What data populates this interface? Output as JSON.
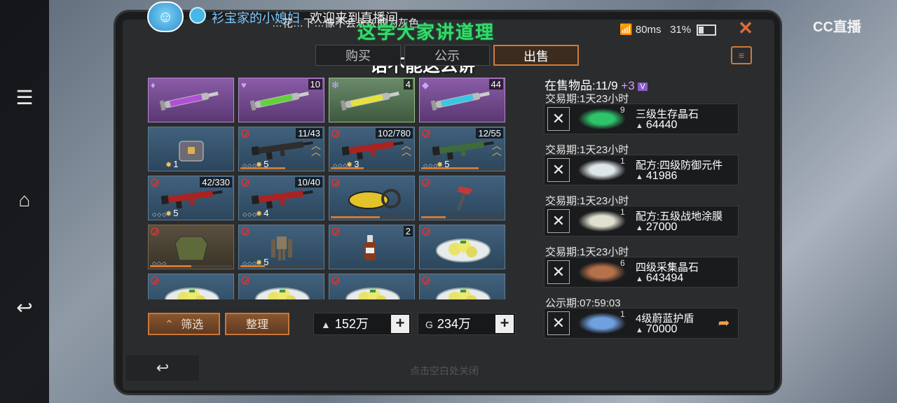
{
  "stream": {
    "avatar_emoji": "☺",
    "streamer_name": "衫宝家的小媳妇",
    "welcome_text": "欢迎来到直播间",
    "marquee_text": "…花…下…像不会永久成为灰色",
    "subtitle_green": "这学大家讲道理",
    "subtitle_white": "话不能这么讲",
    "platform_logo": "CC直播"
  },
  "status": {
    "ping": "80ms",
    "battery": "31%"
  },
  "tabs": [
    {
      "label": "购买",
      "active": false
    },
    {
      "label": "公示",
      "active": false
    },
    {
      "label": "出售",
      "active": true
    }
  ],
  "inventory": [
    {
      "row": 0,
      "col": 0,
      "rarity": "rare",
      "item": "syringe-purple-icon",
      "count": "",
      "corner": "♦",
      "color": "#b04fd8"
    },
    {
      "row": 0,
      "col": 1,
      "rarity": "rare",
      "item": "syringe-green-icon",
      "count": "10",
      "corner": "♥",
      "color": "#62d23a"
    },
    {
      "row": 0,
      "col": 2,
      "rarity": "epic",
      "item": "syringe-yellow-icon",
      "count": "4",
      "corner": "✻",
      "color": "#e6e23a"
    },
    {
      "row": 0,
      "col": 3,
      "rarity": "rare",
      "item": "syringe-cyan-icon",
      "count": "44",
      "corner": "◆",
      "color": "#39c6e6"
    },
    {
      "row": 1,
      "col": 0,
      "item": "chest-icon",
      "level": "1",
      "dots": "",
      "count": "",
      "ban": false,
      "progress": 0
    },
    {
      "row": 1,
      "col": 1,
      "item": "rifle-icon",
      "level": "5",
      "dots": "◇◇◇",
      "count": "11/43",
      "ban": true,
      "progress": 0.55,
      "upgrade": true
    },
    {
      "row": 1,
      "col": 2,
      "item": "red-shotgun-icon",
      "level": "3",
      "dots": "◇◇◇",
      "count": "102/780",
      "ban": true,
      "progress": 0.4,
      "upgrade": true
    },
    {
      "row": 1,
      "col": 3,
      "item": "camo-rifle-icon",
      "level": "5",
      "dots": "◇◇◇",
      "count": "12/55",
      "ban": true,
      "progress": 0.7,
      "upgrade": true
    },
    {
      "row": 2,
      "col": 0,
      "item": "red-assault-rifle-icon",
      "level": "5",
      "dots": "◇◇◇",
      "count": "42/330",
      "ban": true,
      "progress": 0
    },
    {
      "row": 2,
      "col": 1,
      "item": "red-rifle-icon",
      "level": "4",
      "dots": "◇◇◇",
      "count": "10/40",
      "ban": true,
      "progress": 0
    },
    {
      "row": 2,
      "col": 2,
      "item": "chainsaw-icon",
      "level": "",
      "dots": "",
      "count": "",
      "ban": true,
      "progress": 0.6
    },
    {
      "row": 2,
      "col": 3,
      "item": "axe-icon",
      "level": "",
      "dots": "",
      "count": "",
      "ban": true,
      "progress": 0.3
    },
    {
      "row": 3,
      "col": 0,
      "rarity": "dark",
      "item": "armor-vest-icon",
      "level": "",
      "dots": "◇◇◇",
      "count": "",
      "ban": true,
      "progress": 0.5
    },
    {
      "row": 3,
      "col": 1,
      "item": "exoskeleton-icon",
      "level": "5",
      "dots": "◇◇◇",
      "count": "",
      "ban": true,
      "progress": 0.3
    },
    {
      "row": 3,
      "col": 2,
      "item": "bottle-icon",
      "level": "",
      "dots": "",
      "count": "2",
      "ban": true,
      "progress": 0
    },
    {
      "row": 3,
      "col": 3,
      "item": "food-plate-icon",
      "level": "",
      "dots": "",
      "count": "",
      "ban": true,
      "progress": 0
    },
    {
      "row": 4,
      "col": 0,
      "item": "food-plate-icon",
      "level": "",
      "dots": "",
      "count": "",
      "ban": true,
      "progress": 0
    },
    {
      "row": 4,
      "col": 1,
      "item": "food-plate-icon",
      "level": "",
      "dots": "",
      "count": "",
      "ban": true,
      "progress": 0
    },
    {
      "row": 4,
      "col": 2,
      "item": "food-plate-icon",
      "level": "",
      "dots": "",
      "count": "",
      "ban": true,
      "progress": 0
    },
    {
      "row": 4,
      "col": 3,
      "item": "food-plate-icon",
      "level": "",
      "dots": "",
      "count": "",
      "ban": true,
      "progress": 0
    }
  ],
  "buttons": {
    "filter": "筛选",
    "sort": "整理"
  },
  "currency": [
    {
      "symbol": "▲",
      "amount": "152万"
    },
    {
      "symbol": "G",
      "amount": "234万"
    }
  ],
  "onsale": {
    "label": "在售物品:11/9",
    "extra": "+3",
    "vip": "V"
  },
  "sales": [
    {
      "period": "交易期:1天23小时",
      "name": "三级生存晶石",
      "qty": "9",
      "price": "64440",
      "thumb_color": "#2fc46a",
      "share": false
    },
    {
      "period": "交易期:1天23小时",
      "name": "配方:四级防御元件",
      "qty": "1",
      "price": "41986",
      "thumb_color": "#dfe6ea",
      "share": false
    },
    {
      "period": "交易期:1天23小时",
      "name": "配方:五级战地涂膜",
      "qty": "1",
      "price": "27000",
      "thumb_color": "#e0e0d0",
      "share": false
    },
    {
      "period": "交易期:1天23小时",
      "name": "四级采集晶石",
      "qty": "6",
      "price": "643494",
      "thumb_color": "#b7714a",
      "share": false
    },
    {
      "period": "公示期:07:59:03",
      "name": "4级蔚蓝护盾",
      "qty": "1",
      "price": "70000",
      "thumb_color": "#6fa0e0",
      "share": true
    }
  ],
  "footer": {
    "hint": "点击空白处关闭"
  }
}
